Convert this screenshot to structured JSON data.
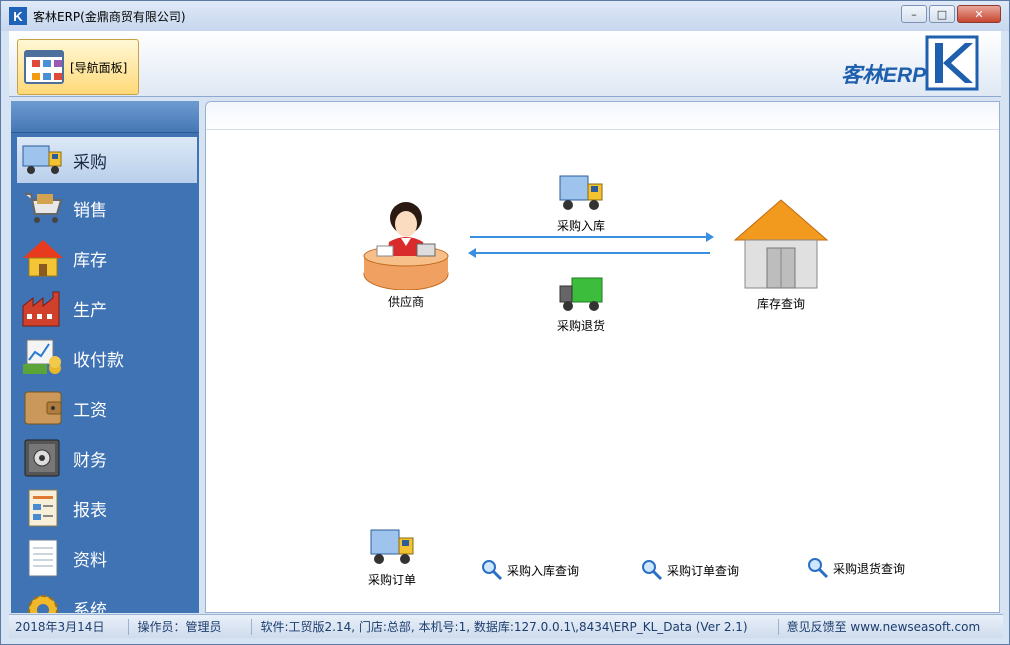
{
  "window": {
    "title": "客林ERP(金鼎商贸有限公司)",
    "app_icon_letter": "K",
    "controls": {
      "minimize": "–",
      "maximize": "□",
      "close": "✕"
    }
  },
  "ribbon": {
    "nav_panel_label": "[导航面板]",
    "brand_text": "客林ERP"
  },
  "sidebar": {
    "items": [
      {
        "label": "采购",
        "icon": "truck-icon",
        "active": true
      },
      {
        "label": "销售",
        "icon": "shopping-cart-icon"
      },
      {
        "label": "库存",
        "icon": "house-icon"
      },
      {
        "label": "生产",
        "icon": "factory-icon"
      },
      {
        "label": "收付款",
        "icon": "money-chart-icon"
      },
      {
        "label": "工资",
        "icon": "wallet-icon"
      },
      {
        "label": "财务",
        "icon": "safe-icon"
      },
      {
        "label": "报表",
        "icon": "report-icon"
      },
      {
        "label": "资料",
        "icon": "document-icon"
      },
      {
        "label": "系统",
        "icon": "gear-icon"
      }
    ]
  },
  "flow": {
    "supplier": "供应商",
    "purchase_in": "采购入库",
    "purchase_return": "采购退货",
    "inventory_query": "库存查询",
    "purchase_order": "采购订单",
    "purchase_in_query": "采购入库查询",
    "purchase_order_query": "采购订单查询",
    "purchase_return_query": "采购退货查询"
  },
  "status": {
    "date": "2018年3月14日",
    "operator": "操作员：管理员",
    "info": "软件:工贸版2.14, 门店:总部, 本机号:1,   数据库:127.0.0.1\\,8434\\ERP_KL_Data (Ver 2.1)",
    "feedback": "意见反馈至 www.newseasoft.com"
  },
  "colors": {
    "sidebar_bg": "#3f73b3",
    "arrow": "#3b8fe0",
    "brand": "#1e5fae"
  }
}
